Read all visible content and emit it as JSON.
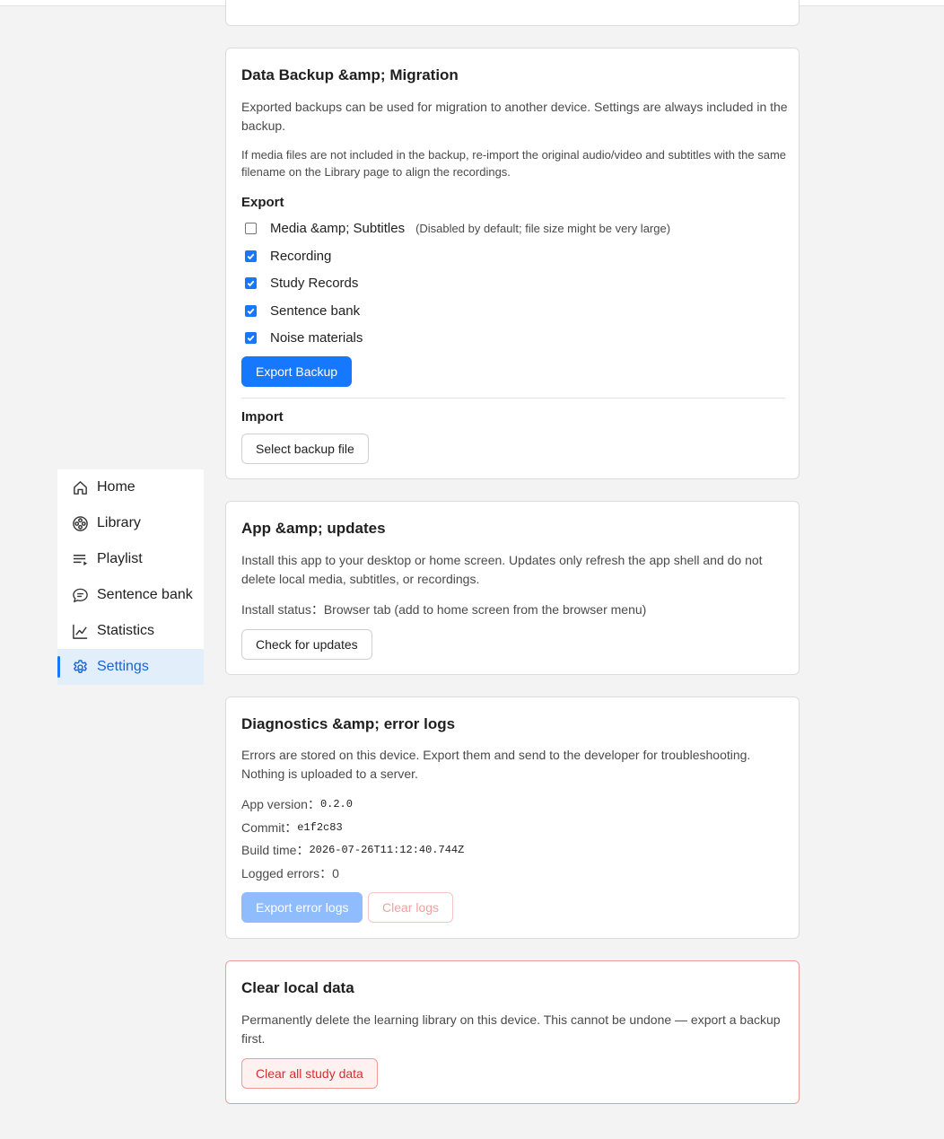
{
  "sidebar": {
    "items": [
      {
        "label": "Home",
        "icon": "home-icon"
      },
      {
        "label": "Library",
        "icon": "film-reel-icon"
      },
      {
        "label": "Playlist",
        "icon": "playlist-icon"
      },
      {
        "label": "Sentence bank",
        "icon": "chat-bubble-icon"
      },
      {
        "label": "Statistics",
        "icon": "line-chart-icon"
      },
      {
        "label": "Settings",
        "icon": "gear-icon",
        "active": true
      }
    ]
  },
  "backup": {
    "title": "Data Backup &amp; Migration",
    "desc1": "Exported backups can be used for migration to another device. Settings are always included in the backup.",
    "desc2": "If media files are not included in the backup, re-import the original audio/video and subtitles with the same filename on the Library page to align the recordings.",
    "export_heading": "Export",
    "options": [
      {
        "label": "Media &amp; Subtitles",
        "hint": "(Disabled by default; file size might be very large)",
        "checked": false
      },
      {
        "label": "Recording",
        "checked": true
      },
      {
        "label": "Study Records",
        "checked": true
      },
      {
        "label": "Sentence bank",
        "checked": true
      },
      {
        "label": "Noise materials",
        "checked": true
      }
    ],
    "export_button": "Export Backup",
    "import_heading": "Import",
    "import_button": "Select backup file"
  },
  "app": {
    "title": "App &amp; updates",
    "desc": "Install this app to your desktop or home screen. Updates only refresh the app shell and do not delete local media, subtitles, or recordings.",
    "install_status_label": "Install status：",
    "install_status_value": "Browser tab (add to home screen from the browser menu)",
    "check_button": "Check for updates"
  },
  "diagnostics": {
    "title": "Diagnostics &amp; error logs",
    "desc": "Errors are stored on this device. Export them and send to the developer for troubleshooting. Nothing is uploaded to a server.",
    "version_label": "App version：",
    "version_value": "0.2.0",
    "commit_label": "Commit：",
    "commit_value": "e1f2c83",
    "build_label": "Build time：",
    "build_value": "2026-07-26T11:12:40.744Z",
    "errors_label": "Logged errors：",
    "errors_value": "0",
    "export_logs_button": "Export error logs",
    "clear_logs_button": "Clear logs"
  },
  "clear": {
    "title": "Clear local data",
    "desc": "Permanently delete the learning library on this device. This cannot be undone — export a backup first.",
    "clear_button": "Clear all study data"
  },
  "colors": {
    "accent": "#1677ff",
    "active_bg": "#e3eefb",
    "danger": "#d32f2f",
    "danger_border": "#ef9a9a"
  }
}
